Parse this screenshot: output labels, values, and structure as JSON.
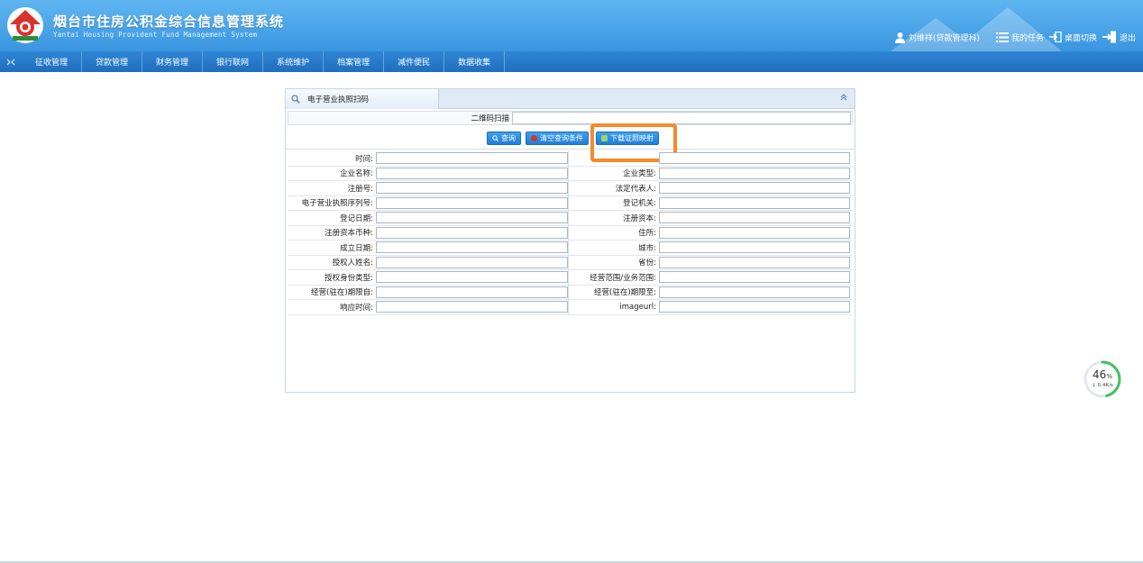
{
  "header": {
    "title": "烟台市住房公积金综合信息管理系统",
    "subtitle": "Yantai Housing Provident Fund Management System",
    "user": "刘维祥(贷款管理科)",
    "my_tasks": "我的任务",
    "desktop_switch": "桌面切换",
    "logout": "退出"
  },
  "nav": {
    "items": [
      "征收管理",
      "贷款管理",
      "财务管理",
      "银行联网",
      "系统维护",
      "档案管理",
      "减件便民",
      "数据收集"
    ]
  },
  "panel": {
    "title": "电子营业执照扫码",
    "scan_label": "二维码扫描",
    "scan_value": "",
    "buttons": {
      "query": "查询",
      "clear": "清空查询条件",
      "download": "下载证照映射"
    },
    "fields": [
      {
        "left": "时间:",
        "left_value": "",
        "right": "",
        "right_value": ""
      },
      {
        "left": "企业名称:",
        "left_value": "",
        "right": "企业类型:",
        "right_value": ""
      },
      {
        "left": "注册号:",
        "left_value": "",
        "right": "法定代表人:",
        "right_value": ""
      },
      {
        "left": "电子营业执照序列号:",
        "left_value": "",
        "right": "登记机关:",
        "right_value": ""
      },
      {
        "left": "登记日期:",
        "left_value": "",
        "right": "注册资本:",
        "right_value": ""
      },
      {
        "left": "注册资本币种:",
        "left_value": "",
        "right": "住所:",
        "right_value": ""
      },
      {
        "left": "成立日期:",
        "left_value": "",
        "right": "城市:",
        "right_value": ""
      },
      {
        "left": "授权人姓名:",
        "left_value": "",
        "right": "省份:",
        "right_value": ""
      },
      {
        "left": "授权身份类型:",
        "left_value": "",
        "right": "经营范围/业务范围:",
        "right_value": ""
      },
      {
        "left": "经营(驻在)期限自:",
        "left_value": "",
        "right": "经营(驻在)期限至:",
        "right_value": ""
      },
      {
        "left": "响应时间:",
        "left_value": "",
        "right": "imageurl:",
        "right_value": ""
      }
    ]
  },
  "gauge": {
    "percent": "46",
    "percent_unit": "%",
    "speed": "↓ 0.4K/s",
    "fraction": 0.46
  },
  "colors": {
    "header_blue": "#3a95e0",
    "nav_blue": "#1f6fbe",
    "highlight_orange": "#f58a2a",
    "gauge_green": "#3fc35f"
  }
}
